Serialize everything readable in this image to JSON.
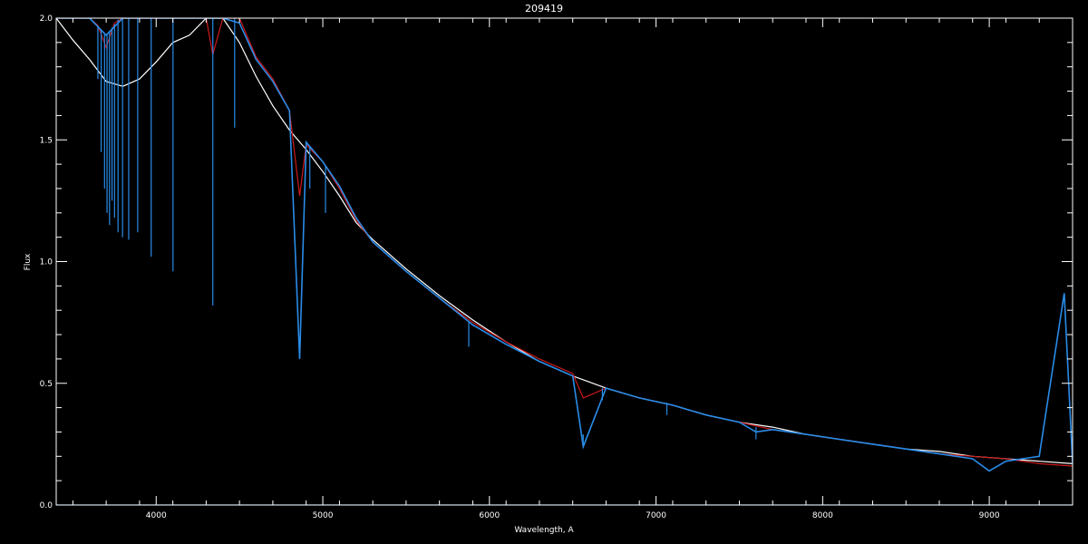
{
  "chart_data": {
    "type": "line",
    "title": "209419",
    "xlabel": "Wavelength, A",
    "ylabel": "Flux",
    "xlim": [
      3400,
      9500
    ],
    "ylim": [
      0.0,
      2.0
    ],
    "x_ticks": [
      4000,
      5000,
      6000,
      7000,
      8000,
      9000
    ],
    "x_tick_labels": [
      "4000",
      "5000",
      "6000",
      "7000",
      "8000",
      "9000"
    ],
    "y_ticks": [
      0.0,
      0.5,
      1.0,
      1.5,
      2.0
    ],
    "y_tick_labels": [
      "0.0",
      "0.5",
      "1.0",
      "1.5",
      "2.0"
    ],
    "grid": false,
    "colors": {
      "background": "#000000",
      "axes": "#ffffff"
    },
    "series": [
      {
        "color": "#ffffff",
        "x": [
          3400,
          3500,
          3600,
          3700,
          3800,
          3900,
          4000,
          4100,
          4200,
          4300,
          4400,
          4500,
          4600,
          4700,
          4800,
          4900,
          5000,
          5100,
          5200,
          5300,
          5500,
          5700,
          5900,
          6100,
          6300,
          6500,
          6700,
          6900,
          7100,
          7300,
          7500,
          7700,
          7900,
          8100,
          8300,
          8500,
          8700,
          8900,
          9100,
          9300,
          9500
        ],
        "y": [
          2.0,
          1.91,
          1.83,
          1.74,
          1.72,
          1.75,
          1.82,
          1.9,
          1.93,
          2.05,
          2.05,
          1.9,
          1.76,
          1.64,
          1.54,
          1.46,
          1.37,
          1.27,
          1.16,
          1.09,
          0.97,
          0.86,
          0.76,
          0.67,
          0.59,
          0.53,
          0.48,
          0.44,
          0.41,
          0.37,
          0.34,
          0.32,
          0.29,
          0.27,
          0.25,
          0.23,
          0.22,
          0.2,
          0.19,
          0.18,
          0.17
        ]
      },
      {
        "color": "#cc1a1a",
        "x": [
          3400,
          3500,
          3600,
          3650,
          3700,
          3750,
          3800,
          3900,
          4000,
          4100,
          4200,
          4300,
          4340,
          4400,
          4500,
          4600,
          4700,
          4800,
          4861,
          4900,
          5000,
          5100,
          5200,
          5300,
          5500,
          5700,
          5900,
          6100,
          6300,
          6500,
          6563,
          6700,
          6900,
          7100,
          7300,
          7500,
          7700,
          7900,
          8100,
          8300,
          8500,
          8700,
          8900,
          9100,
          9300,
          9500
        ],
        "y": [
          2.0,
          2.0,
          2.0,
          1.97,
          1.88,
          1.98,
          2.02,
          2.1,
          2.15,
          2.2,
          2.2,
          2.2,
          1.85,
          2.15,
          2.0,
          1.84,
          1.75,
          1.62,
          1.27,
          1.48,
          1.41,
          1.3,
          1.17,
          1.08,
          0.96,
          0.85,
          0.75,
          0.67,
          0.6,
          0.54,
          0.44,
          0.48,
          0.44,
          0.41,
          0.37,
          0.34,
          0.31,
          0.29,
          0.27,
          0.25,
          0.23,
          0.21,
          0.2,
          0.19,
          0.17,
          0.16
        ]
      },
      {
        "color": "#2a8ce8",
        "x": [
          3400,
          3500,
          3600,
          3700,
          3800,
          3900,
          4000,
          4100,
          4200,
          4300,
          4400,
          4500,
          4600,
          4700,
          4800,
          4861,
          4900,
          5000,
          5100,
          5200,
          5300,
          5500,
          5700,
          5900,
          6100,
          6300,
          6500,
          6563,
          6700,
          6900,
          7100,
          7300,
          7500,
          7600,
          7700,
          7900,
          8100,
          8300,
          8500,
          8700,
          8900,
          9000,
          9100,
          9300,
          9450,
          9500
        ],
        "y": [
          2.0,
          2.0,
          2.0,
          1.93,
          2.02,
          2.08,
          2.12,
          2.15,
          2.18,
          2.2,
          2.2,
          1.98,
          1.83,
          1.74,
          1.62,
          0.6,
          1.49,
          1.41,
          1.31,
          1.18,
          1.08,
          0.96,
          0.85,
          0.74,
          0.66,
          0.59,
          0.53,
          0.24,
          0.48,
          0.44,
          0.41,
          0.37,
          0.34,
          0.3,
          0.31,
          0.29,
          0.27,
          0.25,
          0.23,
          0.21,
          0.19,
          0.14,
          0.18,
          0.2,
          0.87,
          0.17
        ]
      },
      {
        "color": "#2a8ce8",
        "x": [
          3400,
          9500
        ],
        "y": [
          0.0,
          0.0
        ]
      }
    ],
    "absorption_lines": {
      "color": "#2a8ce8",
      "x": [
        3650,
        3670,
        3690,
        3705,
        3720,
        3735,
        3750,
        3771,
        3798,
        3835,
        3889,
        3970,
        4101,
        4340,
        4471,
        4861,
        4922,
        5016,
        5876,
        6563,
        6678,
        7065,
        7600
      ],
      "y": [
        1.75,
        1.45,
        1.3,
        1.2,
        1.15,
        1.25,
        1.18,
        1.12,
        1.1,
        1.09,
        1.12,
        1.02,
        0.96,
        0.82,
        1.55,
        0.6,
        1.3,
        1.2,
        0.65,
        0.24,
        0.43,
        0.37,
        0.27
      ]
    }
  }
}
